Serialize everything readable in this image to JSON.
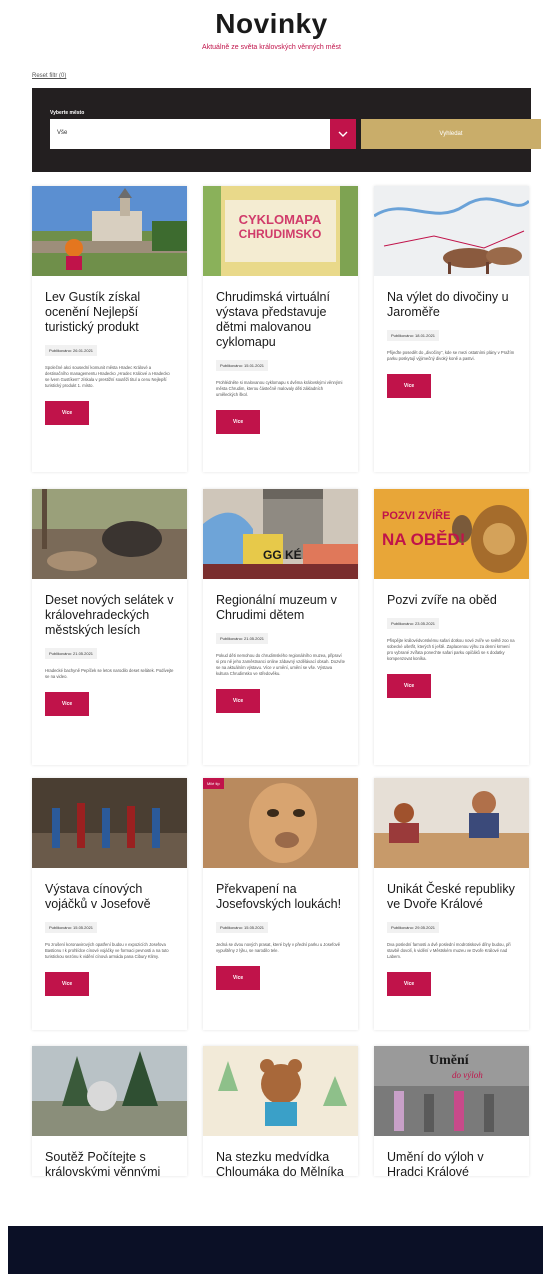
{
  "header": {
    "title": "Novinky",
    "subtitle": "Aktuálně ze světa královských věnných měst"
  },
  "filter": {
    "reset_link": "Reset filtr (0)",
    "label": "Vyberte město",
    "selected_value": "Vše",
    "submit_label": "Vyhledat"
  },
  "more_label": "Více",
  "cards": [
    {
      "title": "Lev Gustík získal ocenění Nejlepší turistický produkt",
      "date": "Publikováno: 26.01.2021",
      "text": "Společné akci sousední komunit města Hradec Králové a destinačního managementu Hradecko „Hradec Králové a Hradecko se lvem Gustíkem\" získala v prestižní soutěži titul a cenu Nejlepší turistický produkt 1. místo.",
      "badge": ""
    },
    {
      "title": "Chrudimská virtuální výstava představuje dětmi malovanou cyklomapu",
      "date": "Publikováno: 15.01.2021",
      "text": "Prohlédněte si malovanou cyklomapu s dvěma královskými věnnými města Chrudim, kterou částečně malovaly děti základních uměleckých škol.",
      "badge": ""
    },
    {
      "title": "Na výlet do divočiny u Jaroměře",
      "date": "Publikováno: 18.01.2021",
      "text": "Přijeďte posedět do „divočiny\", kde se mezi ostatními plány v Pražím parku poskytují výjimečný divoký koně a pastvi.",
      "badge": ""
    },
    {
      "title": "Deset nových selátek v královehradeckých městských lesích",
      "date": "Publikováno: 21.05.2021",
      "text": "Hradecké bachyně Pepíček se letos narodilo deset selátek. Podívejte se na video.",
      "badge": ""
    },
    {
      "title": "Regionální muzeum v Chrudimi dětem",
      "date": "Publikováno: 21.05.2021",
      "text": "Pokud děti nemohou do chrudimského regionálního muzea, připraví si pro ně jeho zaměstnanci online zábavný vzdělávací obsah. Dozvíte se na aktuálním výstavu. Více v umění, umění se vše. Výstava kultura Chrudimsko ve středověku.",
      "badge": ""
    },
    {
      "title": "Pozvi zvíře na oběd",
      "date": "Publikováno: 23.05.2021",
      "text": "Přispějte královédvorskému safari dotkou nové zvíře ve světě zoo na sobecké ušetřit, kterých ti ještě. Zaplacenou výhu za denní krmení pro vybrané zvířata ponechte safari parku opičáků se s dodatky kompenzovat koníka.",
      "badge": ""
    },
    {
      "title": "Výstava cínových vojáčků v Josefově",
      "date": "Publikováno: 15.05.2021",
      "text": "Po zrušení koronavirových opatření budou v expozicích Josefova Bastionu I k prohlídce cínové vojáčky ve formaci pevnosti a na tuto turistickou sezónu k vidění cínová armáda pana Cibury Klimy.",
      "badge": ""
    },
    {
      "title": "Překvapení na Josefovských loukách!",
      "date": "Publikováno: 15.05.2021",
      "text": "Jedná se dvou nových prasat, které byly v přední parku u Josefově vypuštěny z lýku, se narodilo tele.",
      "badge": "Milé tip"
    },
    {
      "title": "Unikát České republiky ve Dvoře Králové",
      "date": "Publikováno: 29.05.2021",
      "text": "Dva poslední farnosti a dvě poslední modrotiskové dílny budou, při stavbě dovolí, k vidění v Městském muzeu ve Dvoře Králové nad Labem.",
      "badge": ""
    },
    {
      "title": "Soutěž Počítejte s královskými věnnými",
      "date": "",
      "text": "",
      "badge": ""
    },
    {
      "title": "Na stezku medvídka Chloumáka do Mělníka",
      "date": "",
      "text": "",
      "badge": ""
    },
    {
      "title": "Umění do výloh v Hradci Králové",
      "date": "",
      "text": "",
      "badge": ""
    }
  ],
  "image_text": {
    "cyklomapa_title": "CYKLOMAPA",
    "cyklomapa_sub": "CHRUDIMSKO",
    "pozvi_line1": "POZVI ZVÍŘE",
    "pozvi_line2": "NA OBĚD!",
    "umeni_line1": "Umění",
    "umeni_line2": "do výloh",
    "museum_text": "GG KÉ"
  }
}
